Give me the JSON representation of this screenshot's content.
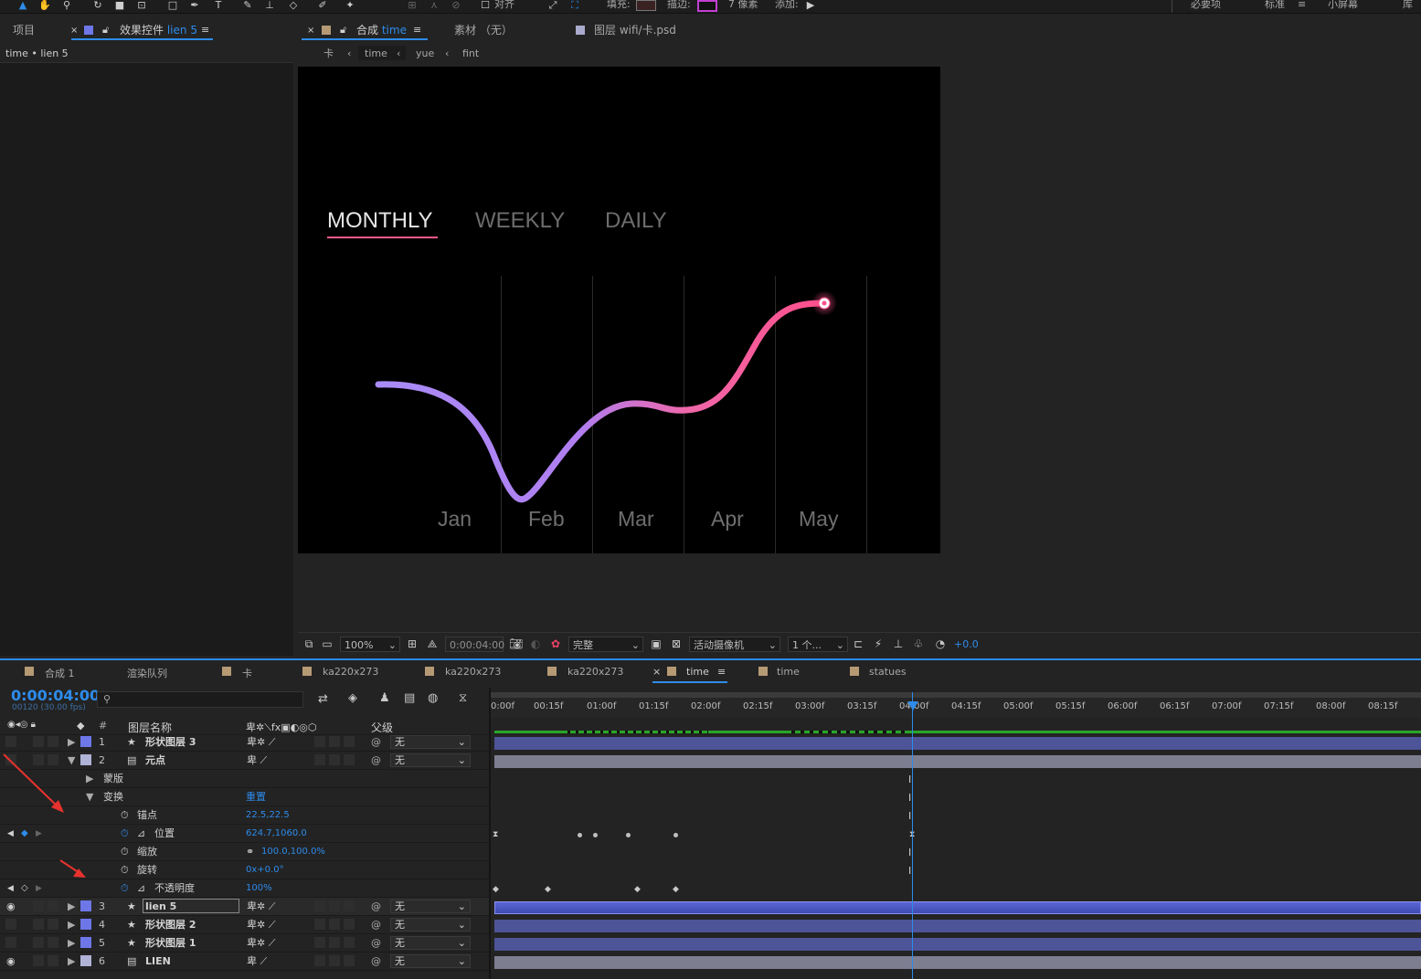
{
  "toolbar": {
    "align_label": "对齐",
    "fill_label": "填充:",
    "stroke_label": "描边:",
    "stroke_px": "7 像素",
    "add_label": "添加:",
    "workspaces": [
      "必要项",
      "标准",
      "小屏幕",
      "库"
    ],
    "colors": {
      "accent": "#2d8ceb",
      "stroke_swatch": "#c13fd1",
      "fill_swatch": "#c23b3b"
    }
  },
  "left_panel": {
    "tab_project": "项目",
    "tab_effects": "效果控件",
    "tab_effects_layer": "lien 5",
    "breadcrumb": "time • lien 5"
  },
  "comp_panel": {
    "tab_comp_prefix": "合成",
    "tab_comp_name": "time",
    "tab_footage": "素材 （无）",
    "tab_layer": "图层 wifi/卡.psd",
    "crumbs": [
      "卡",
      "time",
      "yue",
      "fint"
    ]
  },
  "canvas": {
    "tabs": [
      "MONTHLY",
      "WEEKLY",
      "DAILY"
    ],
    "active_tab": "MONTHLY",
    "months": [
      "Jan",
      "Feb",
      "Mar",
      "Apr",
      "May"
    ],
    "colors": {
      "line_start": "#a98cf7",
      "line_end": "#ff4f8b",
      "underline": "#ff5a8c"
    }
  },
  "viewer_bar": {
    "zoom": "100%",
    "timecode": "0:00:04:00",
    "resolution": "完整",
    "camera": "活动摄像机",
    "views": "1 个...",
    "exposure": "+0.0"
  },
  "timeline": {
    "tabs": [
      "合成 1",
      "渲染队列",
      "卡",
      "ka220x273",
      "ka220x273",
      "ka220x273",
      "time",
      "time",
      "statues"
    ],
    "active_tab": "time",
    "timecode": "0:00:04:00",
    "fps": "00120 (30.00 fps)",
    "search_placeholder": "",
    "col_layer_name": "图层名称",
    "col_parent": "父级",
    "ruler": [
      "0:00f",
      "00:15f",
      "01:00f",
      "01:15f",
      "02:00f",
      "02:15f",
      "03:00f",
      "03:15f",
      "04:00f",
      "04:15f",
      "05:00f",
      "05:15f",
      "06:00f",
      "06:15f",
      "07:00f",
      "07:15f",
      "08:00f",
      "08:15f"
    ],
    "layers": [
      {
        "num": "1",
        "name": "形状图层 3",
        "parent": "无"
      },
      {
        "num": "2",
        "name": "元点",
        "parent": "无"
      },
      {
        "num": "3",
        "name": "lien 5",
        "parent": "无"
      },
      {
        "num": "4",
        "name": "形状图层 2",
        "parent": "无"
      },
      {
        "num": "5",
        "name": "形状图层 1",
        "parent": "无"
      },
      {
        "num": "6",
        "name": "LIEN",
        "parent": "无"
      }
    ],
    "props": {
      "mask": "蒙版",
      "transform": "变换",
      "reset": "重置",
      "anchor": "锚点",
      "anchor_val": "22.5,22.5",
      "position": "位置",
      "position_val": "624.7,1060.0",
      "scale": "缩放",
      "scale_val": "100.0,100.0%",
      "rotation": "旋转",
      "rotation_val": "0x+0.0°",
      "opacity": "不透明度",
      "opacity_val": "100%"
    }
  }
}
